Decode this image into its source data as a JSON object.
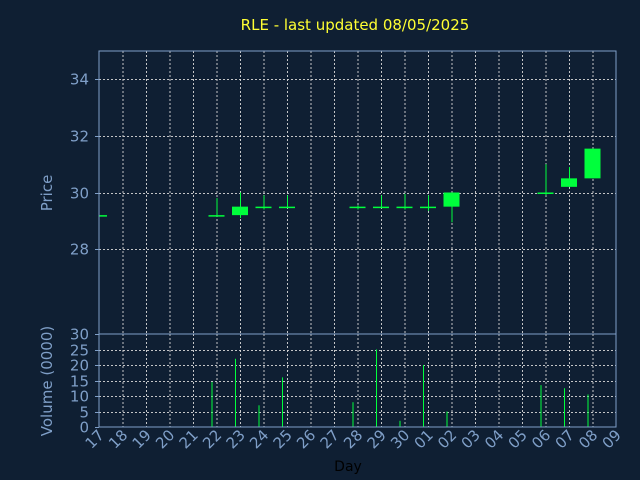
{
  "chart_data": [
    {
      "type": "candlestick",
      "title": "RLE - last updated 08/05/2025",
      "ylabel": "Price",
      "ylim": [
        25,
        35
      ],
      "yticks": [
        28,
        30,
        32,
        34
      ],
      "grid": true,
      "up_color": "#00ff3c",
      "down_color": "#00ff3c",
      "x": [
        "17",
        "18",
        "19",
        "20",
        "21",
        "22",
        "23",
        "24",
        "25",
        "26",
        "27",
        "28",
        "29",
        "30",
        "01",
        "02",
        "03",
        "04",
        "05",
        "06",
        "07",
        "08",
        "09"
      ],
      "candles": [
        {
          "day": "17",
          "open": 29.2,
          "high": 29.2,
          "low": 29.2,
          "close": 29.2
        },
        {
          "day": "22",
          "open": 29.2,
          "high": 29.8,
          "low": 29.15,
          "close": 29.2
        },
        {
          "day": "23",
          "open": 29.2,
          "high": 30.0,
          "low": 29.1,
          "close": 29.5
        },
        {
          "day": "24",
          "open": 29.5,
          "high": 29.9,
          "low": 29.4,
          "close": 29.45
        },
        {
          "day": "25",
          "open": 29.5,
          "high": 29.9,
          "low": 29.45,
          "close": 29.45
        },
        {
          "day": "28",
          "open": 29.5,
          "high": 29.55,
          "low": 29.4,
          "close": 29.45
        },
        {
          "day": "29",
          "open": 29.5,
          "high": 29.9,
          "low": 29.45,
          "close": 29.5
        },
        {
          "day": "30",
          "open": 29.5,
          "high": 29.95,
          "low": 29.4,
          "close": 29.45
        },
        {
          "day": "01",
          "open": 29.5,
          "high": 29.9,
          "low": 29.35,
          "close": 29.45
        },
        {
          "day": "02",
          "open": 29.5,
          "high": 30.0,
          "low": 28.95,
          "close": 30.0
        },
        {
          "day": "06",
          "open": 30.0,
          "high": 31.0,
          "low": 29.9,
          "close": 29.95
        },
        {
          "day": "07",
          "open": 30.2,
          "high": 30.9,
          "low": 30.2,
          "close": 30.5
        },
        {
          "day": "08",
          "open": 30.5,
          "high": 31.55,
          "low": 30.5,
          "close": 31.55
        }
      ]
    },
    {
      "type": "bar",
      "ylabel": "Volume (0000)",
      "xlabel": "Day",
      "ylim": [
        0,
        30
      ],
      "yticks": [
        0,
        5,
        10,
        15,
        20,
        25,
        30
      ],
      "grid": true,
      "bar_color": "#00ff3c",
      "categories": [
        "17",
        "18",
        "19",
        "20",
        "21",
        "22",
        "23",
        "24",
        "25",
        "26",
        "27",
        "28",
        "29",
        "30",
        "01",
        "02",
        "03",
        "04",
        "05",
        "06",
        "07",
        "08",
        "09"
      ],
      "values": [
        0,
        0,
        0,
        0,
        0,
        14.5,
        22,
        7,
        16,
        0,
        0,
        8,
        25,
        2,
        20,
        5,
        0,
        0,
        0,
        13.5,
        12.5,
        10.5,
        0
      ]
    }
  ]
}
